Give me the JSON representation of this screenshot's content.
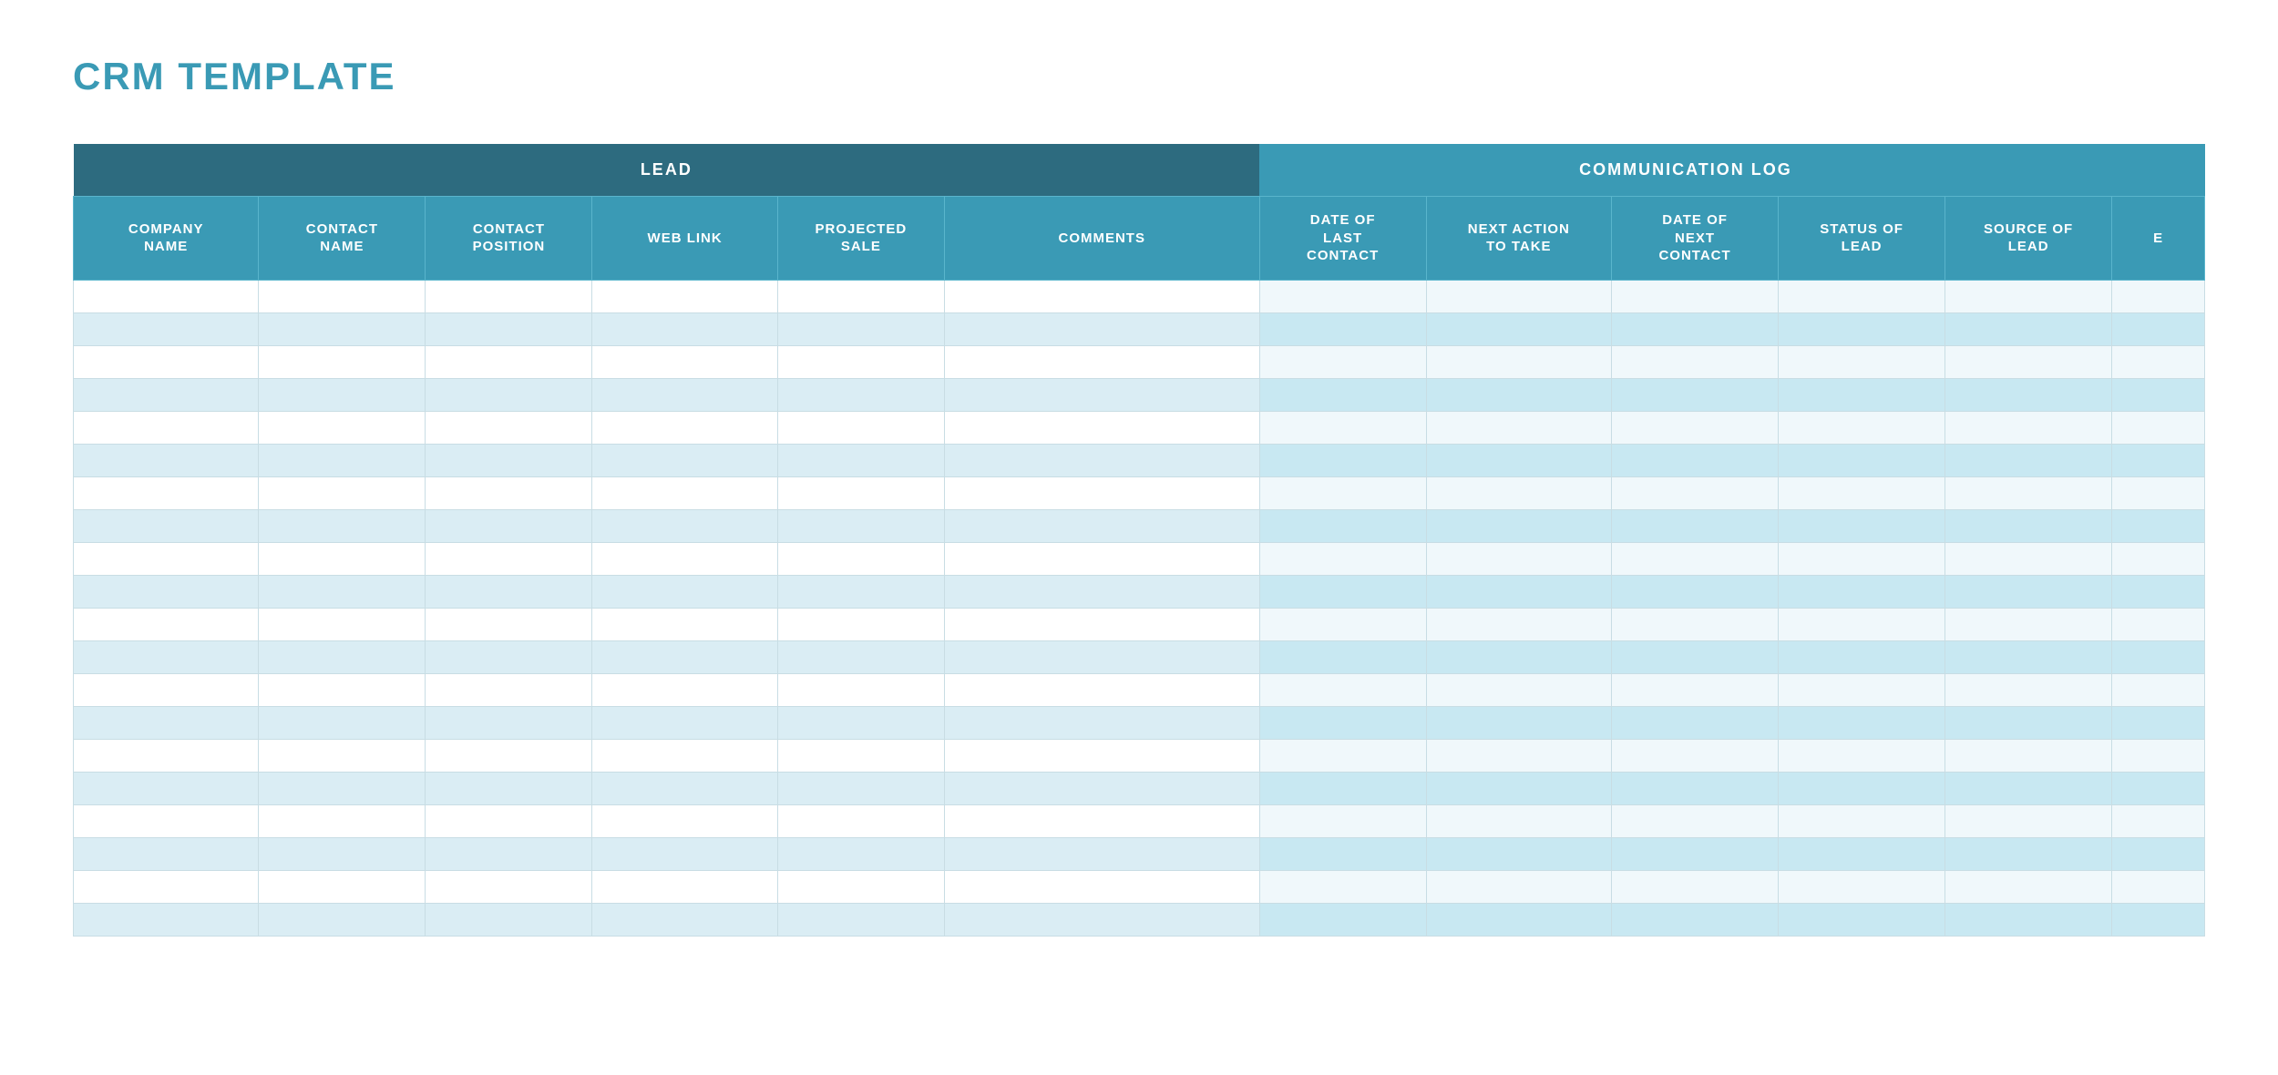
{
  "title": "CRM TEMPLATE",
  "table": {
    "section_lead_label": "LEAD",
    "section_commlog_label": "COMMUNICATION LOG",
    "columns": [
      {
        "id": "company",
        "label": "COMPANY\nNAME",
        "section": "lead"
      },
      {
        "id": "contact_name",
        "label": "CONTACT\nNAME",
        "section": "lead"
      },
      {
        "id": "contact_pos",
        "label": "CONTACT\nPOSITION",
        "section": "lead"
      },
      {
        "id": "weblink",
        "label": "WEB LINK",
        "section": "lead"
      },
      {
        "id": "proj_sale",
        "label": "PROJECTED\nSALE",
        "section": "lead"
      },
      {
        "id": "comments",
        "label": "COMMENTS",
        "section": "lead"
      },
      {
        "id": "date_last",
        "label": "DATE OF\nLAST\nCONTACT",
        "section": "commlog"
      },
      {
        "id": "next_action",
        "label": "NEXT ACTION\nTO TAKE",
        "section": "commlog"
      },
      {
        "id": "date_next",
        "label": "DATE OF\nNEXT\nCONTACT",
        "section": "commlog"
      },
      {
        "id": "status_lead",
        "label": "STATUS OF\nLEAD",
        "section": "commlog"
      },
      {
        "id": "source_lead",
        "label": "SOURCE OF\nLEAD",
        "section": "commlog"
      },
      {
        "id": "extra",
        "label": "E",
        "section": "extra"
      }
    ],
    "num_data_rows": 20
  },
  "colors": {
    "title": "#3a9ab5",
    "header_lead_dark": "#2d6b7f",
    "header_commlog": "#3a9ab5",
    "row_odd": "#ffffff",
    "row_even": "#daedf4",
    "row_odd_comm": "#f0f8fb",
    "row_even_comm": "#c8e8f2"
  }
}
